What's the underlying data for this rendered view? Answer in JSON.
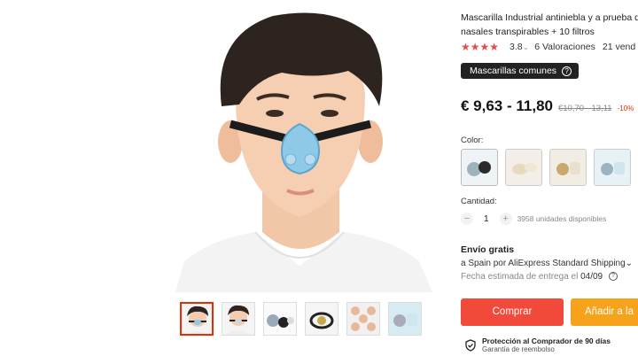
{
  "product": {
    "title_line1": "Mascarilla Industrial antiniebla y a prueba d",
    "title_line2": "nasales transpirables + 10 filtros",
    "stars": "★★★★",
    "rating": "3.8",
    "rating_caret": "⌄",
    "reviews": "6 Valoraciones",
    "sold": "21 vend",
    "category_tag": "Mascarillas comunes",
    "price": "€ 9,63 - 11,80",
    "old_price": "€10,70 - 13,11",
    "discount": "-10%"
  },
  "color": {
    "label": "Color:"
  },
  "quantity": {
    "label": "Cantidad:",
    "minus": "−",
    "value": "1",
    "plus": "+",
    "available": "3958 unidades disponibles"
  },
  "shipping": {
    "title": "Envío gratis",
    "line": "a Spain por AliExpress Standard Shipping⌄",
    "date_label": "Fecha estimada de entrega el",
    "date_value": "04/09"
  },
  "actions": {
    "buy": "Comprar",
    "cart": "Añadir a la"
  },
  "protection": {
    "title": "Protección al Comprador de 90 días",
    "subtitle": "Garantía de reembolso"
  },
  "colors": {
    "accent": "#e62e04",
    "buy_button": "#f24a3a",
    "cart_button": "#f7a21b",
    "stars": "#e34d4d"
  }
}
